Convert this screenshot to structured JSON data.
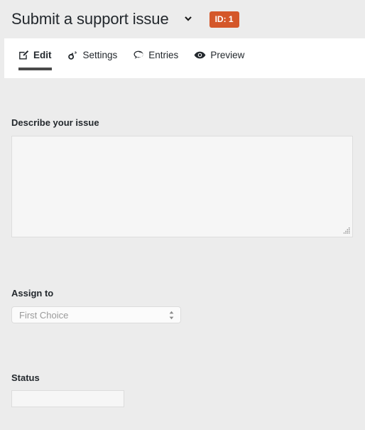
{
  "header": {
    "title": "Submit a support issue",
    "chevron_icon": "chevron-down-icon",
    "id_badge": "ID: 1",
    "badge_color": "#d4572a"
  },
  "tabs": [
    {
      "label": "Edit",
      "icon": "pencil-square-icon",
      "active": true
    },
    {
      "label": "Settings",
      "icon": "gears-icon",
      "active": false
    },
    {
      "label": "Entries",
      "icon": "speech-bubble-icon",
      "active": false
    },
    {
      "label": "Preview",
      "icon": "eye-icon",
      "active": false
    }
  ],
  "form": {
    "describe": {
      "label": "Describe your issue",
      "value": "",
      "placeholder": ""
    },
    "assign": {
      "label": "Assign to",
      "selected": "First Choice"
    },
    "status": {
      "label": "Status",
      "value": "",
      "placeholder": ""
    }
  }
}
